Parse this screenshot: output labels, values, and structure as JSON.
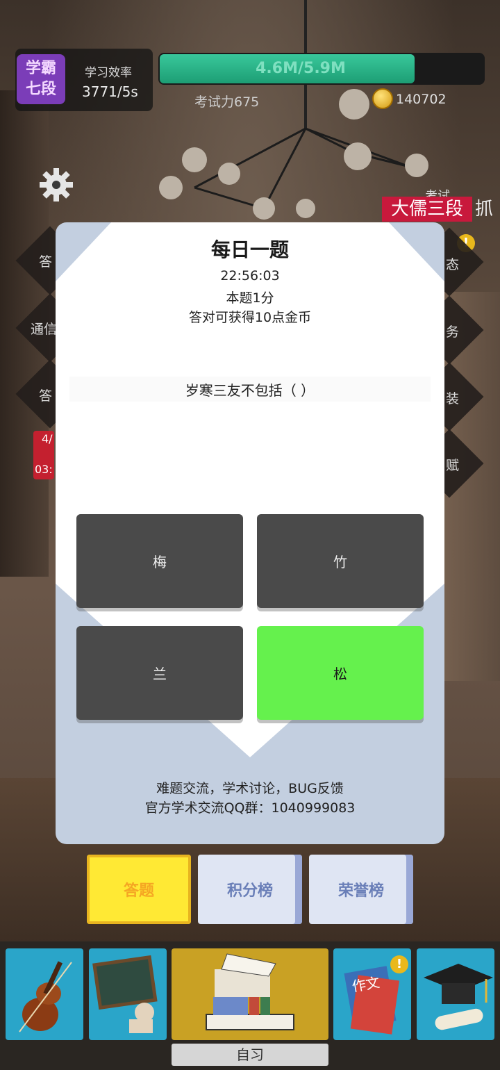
{
  "hud": {
    "rank": "学霸七段",
    "efficiency_label": "学习效率",
    "efficiency_value": "3771/5s",
    "progress_text": "4.6M/5.9M",
    "progress_fraction": 0.78,
    "exam_power": "考试力675",
    "coins": "140702"
  },
  "background": {
    "title_banner": "大儒三段",
    "grab_label": "抓",
    "exam_label": "考试",
    "left_tabs": [
      "答",
      "通信",
      "答"
    ],
    "right_tabs": [
      "态",
      "务",
      "装",
      "赋"
    ],
    "event_top": "4/",
    "event_bottom": "03:"
  },
  "modal": {
    "title": "每日一题",
    "timer": "22:56:03",
    "points": "本题1分",
    "reward": "答对可获得10点金币",
    "question": "岁寒三友不包括（ ）",
    "options": [
      "梅",
      "竹",
      "兰",
      "松"
    ],
    "correct_index": 3,
    "footer_line1": "难题交流，学术讨论，BUG反馈",
    "footer_line2": "官方学术交流QQ群：1040999083"
  },
  "tabs": [
    "答题",
    "积分榜",
    "荣誉榜"
  ],
  "bottom_nav": {
    "items": [
      "violin",
      "chalkboard",
      "books",
      "essay-book",
      "graduation-cap"
    ],
    "center_label": "自习",
    "essay_book_text": "作文"
  },
  "colors": {
    "correct_option": "#65f14d",
    "option": "#4a4a4a",
    "modal_bg": "#c3cfe0",
    "active_tab": "#ffe934",
    "rank_badge": "#7b3db8",
    "title_banner": "#c8193c"
  }
}
